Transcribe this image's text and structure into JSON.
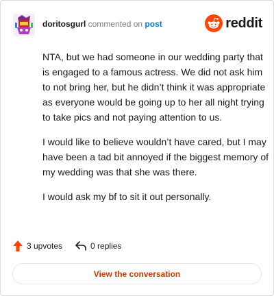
{
  "header": {
    "username": "doritosgurl",
    "action": "commented on",
    "link": "post",
    "brand": "reddit",
    "brand_color": "#ff4500",
    "avatar_icon": "user-avatar-icon"
  },
  "comment": {
    "paragraphs": [
      "NTA, but we had someone in our wedding party that is engaged to a famous actress. We did not ask him to not bring her, but he didn’t think it was appropriate as everyone would be going up to her all night trying to take pics and not paying attention to us.",
      "I would like to believe wouldn’t have cared, but I may have been a tad bit annoyed if the biggest memory of my wedding was that she was there.",
      "I would ask my bf to sit it out personally."
    ]
  },
  "footer": {
    "upvotes": "3 upvotes",
    "replies": "0 replies",
    "upvote_icon": "upvote-arrow-icon",
    "reply_icon": "reply-icon"
  },
  "cta": {
    "label": "View the conversation",
    "color": "#cc3700"
  }
}
